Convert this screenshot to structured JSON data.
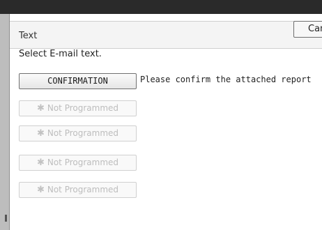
{
  "header": {
    "title": "Text",
    "cancel_label": "Cancel"
  },
  "instruction": "Select E-mail text.",
  "buttons": [
    {
      "label": "CONFIRMATION",
      "enabled": true
    },
    {
      "label": "Not Programmed",
      "enabled": false
    },
    {
      "label": "Not Programmed",
      "enabled": false
    },
    {
      "label": "Not Programmed",
      "enabled": false
    },
    {
      "label": "Not Programmed",
      "enabled": false
    }
  ],
  "selected_text": "Please confirm the attached report",
  "disabled_marker": "✱"
}
